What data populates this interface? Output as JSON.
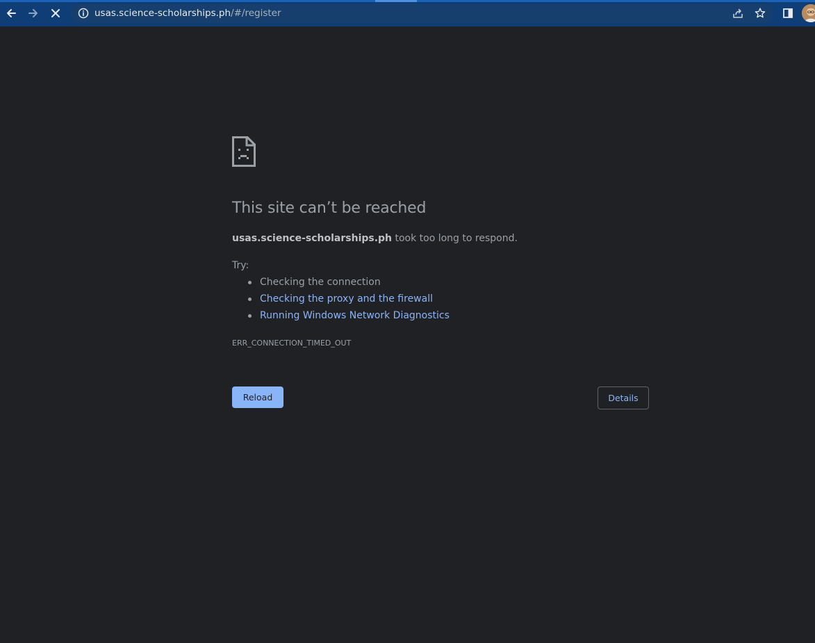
{
  "browser": {
    "url_host": "usas.science-scholarships.ph",
    "url_path": "/#/register"
  },
  "colors": {
    "toolbar": "#0e3e75",
    "page_background": "#202124",
    "link": "#8ab4f8",
    "text": "#9aa0a6"
  },
  "error_page": {
    "icon": "sad-page-icon",
    "heading": "This site can’t be reached",
    "summary_host": "usas.science-scholarships.ph",
    "summary_rest": " took too long to respond.",
    "try_label": "Try:",
    "suggestions": [
      {
        "label": "Checking the connection"
      },
      {
        "label": "Checking the proxy and the firewall"
      },
      {
        "label": "Running Windows Network Diagnostics"
      }
    ],
    "error_code": "ERR_CONNECTION_TIMED_OUT",
    "reload_label": "Reload",
    "details_label": "Details"
  }
}
